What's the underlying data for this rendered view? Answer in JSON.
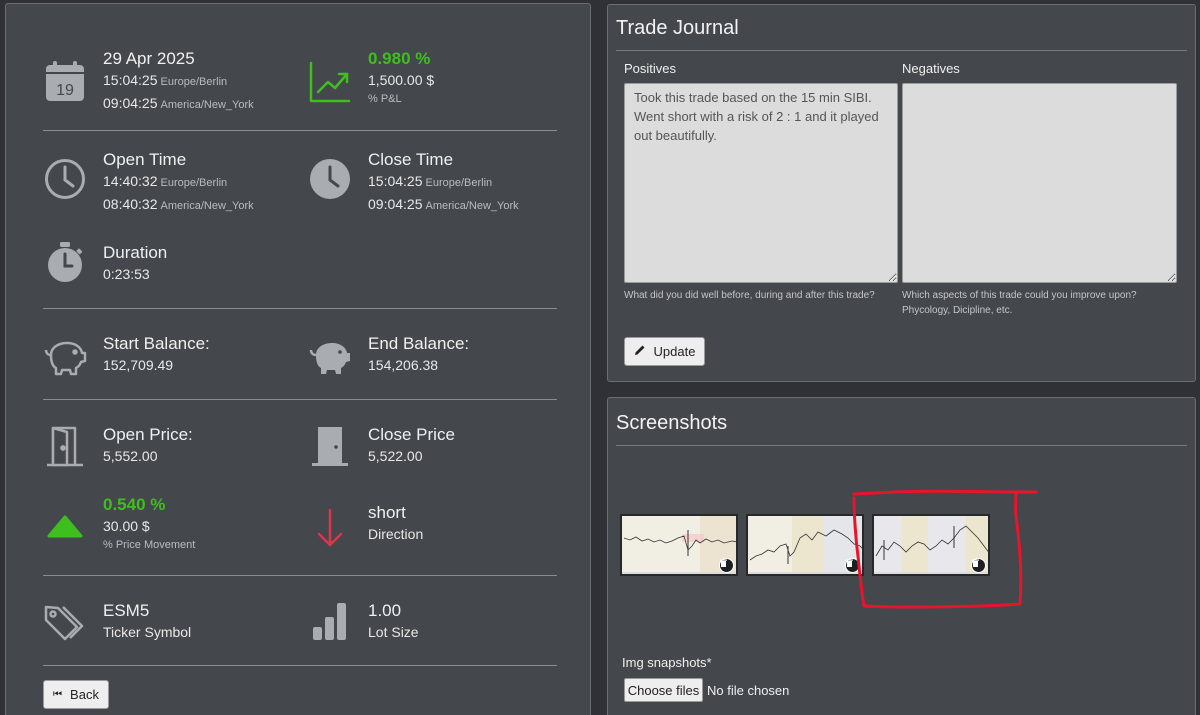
{
  "summary": {
    "date": "29 Apr 2025",
    "date_time_1": "15:04:25",
    "date_tz_1": "Europe/Berlin",
    "date_time_2": "09:04:25",
    "date_tz_2": "America/New_York",
    "calendar_day": "19",
    "pnl_percent": "0.980 %",
    "pnl_value": "1,500.00 $",
    "pnl_caption": "% P&L",
    "open_time_label": "Open Time",
    "open_time_1": "14:40:32",
    "open_tz_1": "Europe/Berlin",
    "open_time_2": "08:40:32",
    "open_tz_2": "America/New_York",
    "close_time_label": "Close Time",
    "close_time_1": "15:04:25",
    "close_tz_1": "Europe/Berlin",
    "close_time_2": "09:04:25",
    "close_tz_2": "America/New_York",
    "duration_label": "Duration",
    "duration_value": "0:23:53",
    "start_balance_label": "Start Balance:",
    "start_balance_value": "152,709.49",
    "end_balance_label": "End Balance:",
    "end_balance_value": "154,206.38",
    "open_price_label": "Open Price:",
    "open_price_value": "5,552.00",
    "close_price_label": "Close Price",
    "close_price_value": "5,522.00",
    "move_percent": "0.540 %",
    "move_value": "30.00 $",
    "move_caption": "% Price Movement",
    "direction_value": "short",
    "direction_label": "Direction",
    "ticker_value": "ESM5",
    "ticker_label": "Ticker Symbol",
    "lot_value": "1.00",
    "lot_label": "Lot Size",
    "back_label": "Back"
  },
  "journal": {
    "title": "Trade Journal",
    "positives_label": "Positives",
    "positives_text": "Took this trade based on the 15 min SIBI. Went short with a risk of 2 : 1 and it played out beautifully.",
    "positives_help": "What did you did well before, during and after this trade?",
    "negatives_label": "Negatives",
    "negatives_text": "",
    "negatives_help_1": "Which aspects of this trade could you improve upon?",
    "negatives_help_2": "Phycology, Dicipline, etc.",
    "update_label": "Update"
  },
  "screenshots": {
    "title": "Screenshots",
    "upload_label": "Img snapshots*",
    "choose_label": "Choose files",
    "no_file_text": "No file chosen"
  },
  "colors": {
    "panel_bg": "#44474c",
    "positive_green": "#3fbf1f",
    "direction_red": "#e0344a",
    "annotation_red": "#e8142c"
  }
}
